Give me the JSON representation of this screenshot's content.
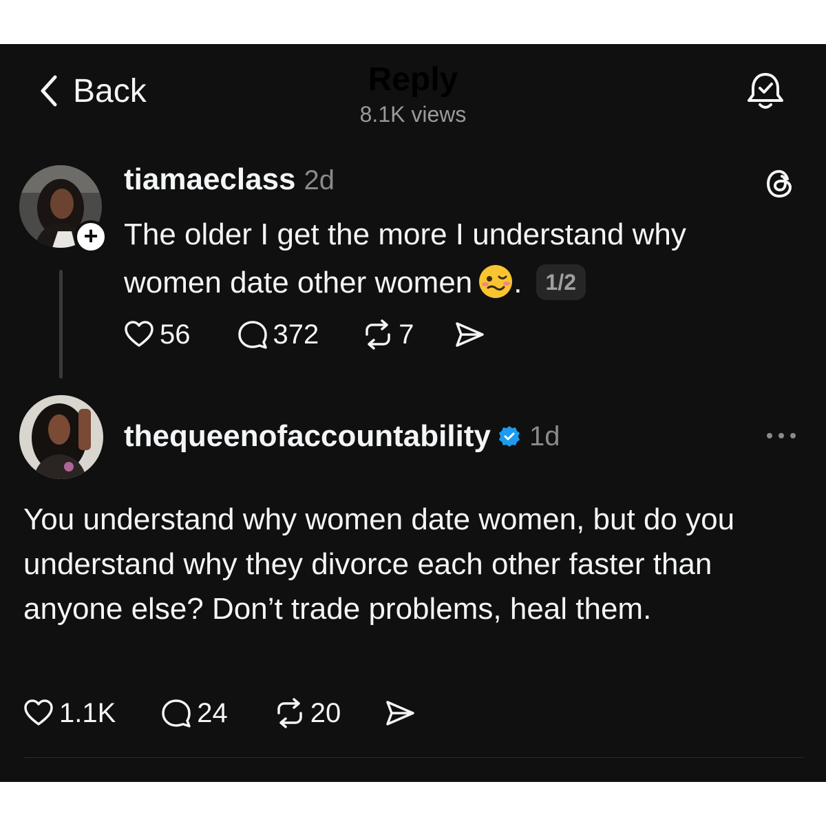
{
  "header": {
    "back_label": "Back",
    "title": "Reply",
    "views": "8.1K views"
  },
  "post": {
    "username": "tiamaeclass",
    "time": "2d",
    "text": "The older I get the more I understand why women date other women",
    "emoji": "woozy-face-emoji",
    "text_suffix": ".",
    "page_indicator": "1/2",
    "likes": "56",
    "comments": "372",
    "reposts": "7"
  },
  "reply": {
    "username": "thequeenofaccountability",
    "time": "1d",
    "text": "You understand why women date women, but do you understand why they divorce each other faster than anyone else? Don’t trade problems, heal them.",
    "likes": "1.1K",
    "comments": "24",
    "reposts": "20"
  },
  "colors": {
    "background": "#101010",
    "text": "#f3f5f7",
    "muted": "#8a8a8a",
    "verified": "#1d9bf0"
  },
  "icons": [
    "chevron-left-icon",
    "bell-check-icon",
    "threads-logo-icon",
    "heart-icon",
    "comment-icon",
    "repost-icon",
    "share-icon",
    "verified-icon",
    "more-icon"
  ]
}
